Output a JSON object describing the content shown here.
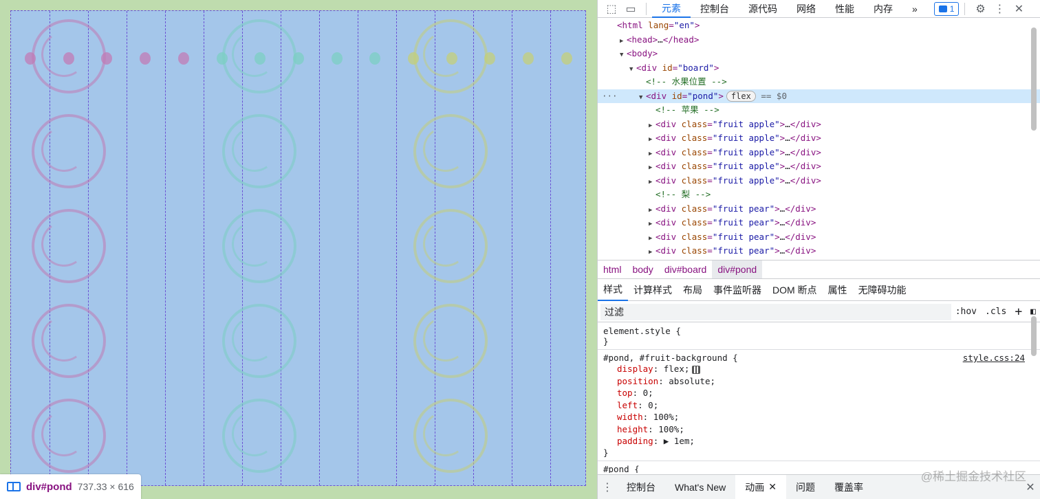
{
  "viewport": {
    "badge": {
      "node": "div#pond",
      "size": "737.33 × 616"
    },
    "colors": {
      "apple": "#c17bb5",
      "pear": "#7ccfc3",
      "lemon": "#c4cf7a"
    }
  },
  "devtools": {
    "toolbar": {
      "tabs": [
        "元素",
        "控制台",
        "源代码",
        "网络",
        "性能",
        "内存"
      ],
      "more": "»",
      "issues_count": "1"
    },
    "dom": {
      "lines": [
        {
          "indent": 0,
          "tri": "",
          "html": "<span class='tag'>&lt;html</span> <span class='attr'>lang</span><span class='tag'>=</span><span class='val'>\"en\"</span><span class='tag'>&gt;</span>"
        },
        {
          "indent": 1,
          "tri": "▶",
          "html": "<span class='tag'>&lt;head&gt;</span>…<span class='tag'>&lt;/head&gt;</span>"
        },
        {
          "indent": 1,
          "tri": "▼",
          "html": "<span class='tag'>&lt;body&gt;</span>"
        },
        {
          "indent": 2,
          "tri": "▼",
          "html": "<span class='tag'>&lt;div</span> <span class='attr'>id</span><span class='tag'>=</span><span class='val'>\"board\"</span><span class='tag'>&gt;</span>"
        },
        {
          "indent": 3,
          "tri": "",
          "html": "<span class='cmt'>&lt;!-- 水果位置 --&gt;</span>"
        },
        {
          "indent": 3,
          "tri": "▼",
          "selected": true,
          "html": "<span class='tag'>&lt;div</span> <span class='attr'>id</span><span class='tag'>=</span><span class='val'>\"pond\"</span><span class='tag'>&gt;</span><span class='flex-pill'>flex</span> <span class='dim'>== $0</span>"
        },
        {
          "indent": 4,
          "tri": "",
          "html": "<span class='cmt'>&lt;!-- 苹果 --&gt;</span>"
        },
        {
          "indent": 4,
          "tri": "▶",
          "html": "<span class='tag'>&lt;div</span> <span class='attr'>class</span><span class='tag'>=</span><span class='val'>\"fruit apple\"</span><span class='tag'>&gt;</span>…<span class='tag'>&lt;/div&gt;</span>"
        },
        {
          "indent": 4,
          "tri": "▶",
          "html": "<span class='tag'>&lt;div</span> <span class='attr'>class</span><span class='tag'>=</span><span class='val'>\"fruit apple\"</span><span class='tag'>&gt;</span>…<span class='tag'>&lt;/div&gt;</span>"
        },
        {
          "indent": 4,
          "tri": "▶",
          "html": "<span class='tag'>&lt;div</span> <span class='attr'>class</span><span class='tag'>=</span><span class='val'>\"fruit apple\"</span><span class='tag'>&gt;</span>…<span class='tag'>&lt;/div&gt;</span>"
        },
        {
          "indent": 4,
          "tri": "▶",
          "html": "<span class='tag'>&lt;div</span> <span class='attr'>class</span><span class='tag'>=</span><span class='val'>\"fruit apple\"</span><span class='tag'>&gt;</span>…<span class='tag'>&lt;/div&gt;</span>"
        },
        {
          "indent": 4,
          "tri": "▶",
          "html": "<span class='tag'>&lt;div</span> <span class='attr'>class</span><span class='tag'>=</span><span class='val'>\"fruit apple\"</span><span class='tag'>&gt;</span>…<span class='tag'>&lt;/div&gt;</span>"
        },
        {
          "indent": 4,
          "tri": "",
          "html": "<span class='cmt'>&lt;!-- 梨 --&gt;</span>"
        },
        {
          "indent": 4,
          "tri": "▶",
          "html": "<span class='tag'>&lt;div</span> <span class='attr'>class</span><span class='tag'>=</span><span class='val'>\"fruit pear\"</span><span class='tag'>&gt;</span>…<span class='tag'>&lt;/div&gt;</span>"
        },
        {
          "indent": 4,
          "tri": "▶",
          "html": "<span class='tag'>&lt;div</span> <span class='attr'>class</span><span class='tag'>=</span><span class='val'>\"fruit pear\"</span><span class='tag'>&gt;</span>…<span class='tag'>&lt;/div&gt;</span>"
        },
        {
          "indent": 4,
          "tri": "▶",
          "html": "<span class='tag'>&lt;div</span> <span class='attr'>class</span><span class='tag'>=</span><span class='val'>\"fruit pear\"</span><span class='tag'>&gt;</span>…<span class='tag'>&lt;/div&gt;</span>"
        },
        {
          "indent": 4,
          "tri": "▶",
          "html": "<span class='tag'>&lt;div</span> <span class='attr'>class</span><span class='tag'>=</span><span class='val'>\"fruit pear\"</span><span class='tag'>&gt;</span>…<span class='tag'>&lt;/div&gt;</span>"
        }
      ]
    },
    "breadcrumb": [
      "html",
      "body",
      "div#board",
      "div#pond"
    ],
    "sub_tabs": [
      "样式",
      "计算样式",
      "布局",
      "事件监听器",
      "DOM 断点",
      "属性",
      "无障碍功能"
    ],
    "filter": {
      "placeholder": "过滤",
      "hov": ":hov",
      "cls": ".cls",
      "plus": "+"
    },
    "styles": {
      "element_style": "element.style {",
      "close_brace": "}",
      "rule_selector": "#pond, #fruit-background {",
      "rule_source": "style.css:24",
      "props": [
        {
          "name": "display",
          "value": "flex;"
        },
        {
          "name": "position",
          "value": "absolute;"
        },
        {
          "name": "top",
          "value": "0;"
        },
        {
          "name": "left",
          "value": "0;"
        },
        {
          "name": "width",
          "value": "100%;"
        },
        {
          "name": "height",
          "value": "100%;"
        },
        {
          "name": "padding",
          "value": "▶ 1em;"
        }
      ],
      "next_selector": "#pond {"
    },
    "drawer": {
      "tabs": [
        "控制台",
        "What's New",
        "动画",
        "问题",
        "覆盖率"
      ],
      "active": "动画"
    },
    "watermark": "@稀土掘金技术社区"
  }
}
